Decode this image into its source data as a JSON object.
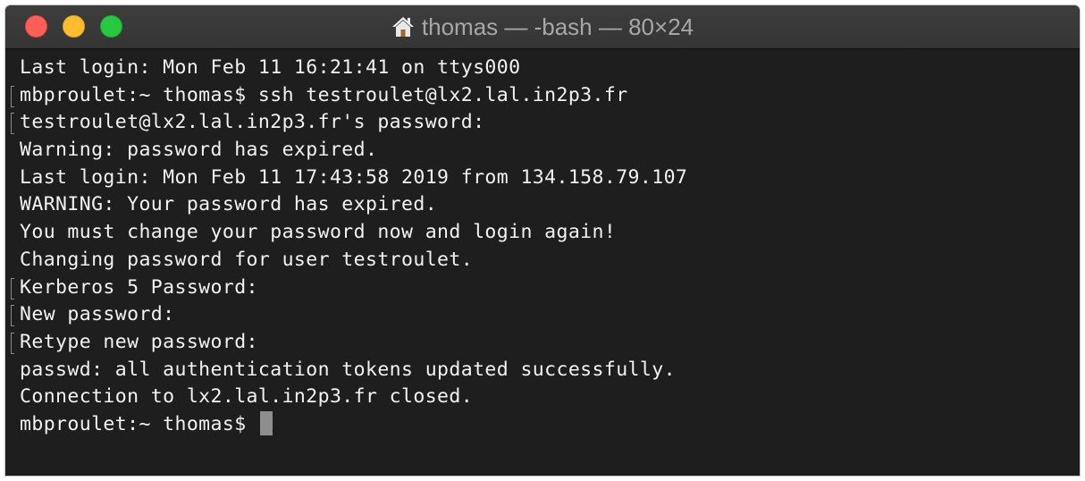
{
  "window": {
    "title": "thomas — -bash — 80×24",
    "title_icon": "home-icon",
    "traffic_lights": {
      "close_color": "#fe5f57",
      "minimize_color": "#febc2e",
      "zoom_color": "#28c840"
    }
  },
  "terminal": {
    "background": "#1e1e1e",
    "foreground": "#f2f2f2",
    "lines": [
      {
        "text": "Last login: Mon Feb 11 16:21:41 on ttys000",
        "marked": false
      },
      {
        "text": "mbproulet:~ thomas$ ssh testroulet@lx2.lal.in2p3.fr",
        "marked": true
      },
      {
        "text": "testroulet@lx2.lal.in2p3.fr's password:",
        "marked": true
      },
      {
        "text": "Warning: password has expired.",
        "marked": false
      },
      {
        "text": "Last login: Mon Feb 11 17:43:58 2019 from 134.158.79.107",
        "marked": false
      },
      {
        "text": "WARNING: Your password has expired.",
        "marked": false
      },
      {
        "text": "You must change your password now and login again!",
        "marked": false
      },
      {
        "text": "Changing password for user testroulet.",
        "marked": false
      },
      {
        "text": "Kerberos 5 Password:",
        "marked": true
      },
      {
        "text": "New password:",
        "marked": true
      },
      {
        "text": "Retype new password:",
        "marked": true
      },
      {
        "text": "passwd: all authentication tokens updated successfully.",
        "marked": false
      },
      {
        "text": "Connection to lx2.lal.in2p3.fr closed.",
        "marked": false
      }
    ],
    "prompt": "mbproulet:~ thomas$ "
  }
}
